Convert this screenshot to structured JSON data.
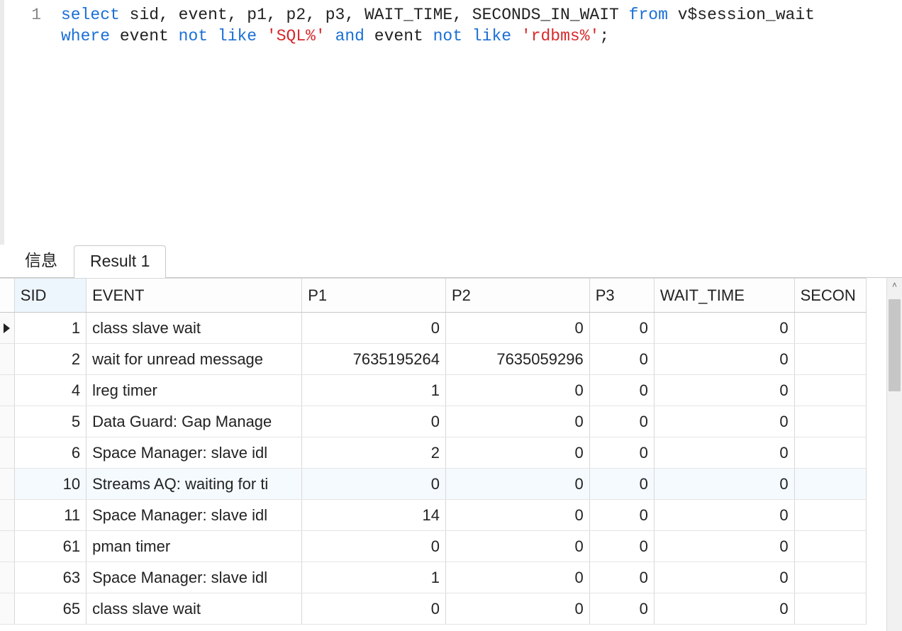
{
  "editor": {
    "line_number": "1",
    "tokens_line1": [
      {
        "t": "select",
        "c": "kw"
      },
      {
        "t": " ",
        "c": "id"
      },
      {
        "t": "sid",
        "c": "id"
      },
      {
        "t": ", ",
        "c": "punc"
      },
      {
        "t": "event",
        "c": "id"
      },
      {
        "t": ", ",
        "c": "punc"
      },
      {
        "t": "p1",
        "c": "id"
      },
      {
        "t": ", ",
        "c": "punc"
      },
      {
        "t": "p2",
        "c": "id"
      },
      {
        "t": ", ",
        "c": "punc"
      },
      {
        "t": "p3",
        "c": "id"
      },
      {
        "t": ", ",
        "c": "punc"
      },
      {
        "t": "WAIT_TIME",
        "c": "id"
      },
      {
        "t": ", ",
        "c": "punc"
      },
      {
        "t": "SECONDS_IN_WAIT",
        "c": "id"
      },
      {
        "t": " ",
        "c": "id"
      },
      {
        "t": "from",
        "c": "kw"
      },
      {
        "t": " ",
        "c": "id"
      },
      {
        "t": "v$session_wait",
        "c": "id"
      }
    ],
    "tokens_line2": [
      {
        "t": "where",
        "c": "kw"
      },
      {
        "t": " ",
        "c": "id"
      },
      {
        "t": "event",
        "c": "id"
      },
      {
        "t": " ",
        "c": "id"
      },
      {
        "t": "not",
        "c": "kw"
      },
      {
        "t": " ",
        "c": "id"
      },
      {
        "t": "like",
        "c": "kw"
      },
      {
        "t": " ",
        "c": "id"
      },
      {
        "t": "'SQL%'",
        "c": "str"
      },
      {
        "t": " ",
        "c": "id"
      },
      {
        "t": "and",
        "c": "kw"
      },
      {
        "t": " ",
        "c": "id"
      },
      {
        "t": "event",
        "c": "id"
      },
      {
        "t": " ",
        "c": "id"
      },
      {
        "t": "not",
        "c": "kw"
      },
      {
        "t": " ",
        "c": "id"
      },
      {
        "t": "like",
        "c": "kw"
      },
      {
        "t": " ",
        "c": "id"
      },
      {
        "t": "'rdbms%'",
        "c": "str"
      },
      {
        "t": ";",
        "c": "punc"
      }
    ]
  },
  "tabs": {
    "info_label": "信息",
    "result1_label": "Result 1"
  },
  "grid": {
    "columns": [
      "SID",
      "EVENT",
      "P1",
      "P2",
      "P3",
      "WAIT_TIME",
      "SECON"
    ],
    "full_last_column": "SECONDS_IN_WAIT",
    "rows": [
      {
        "sid": "1",
        "event": "class slave wait",
        "p1": "0",
        "p2": "0",
        "p3": "0",
        "wt": "0",
        "sec": "",
        "current": true
      },
      {
        "sid": "2",
        "event": "wait for unread message",
        "p1": "7635195264",
        "p2": "7635059296",
        "p3": "0",
        "wt": "0",
        "sec": ""
      },
      {
        "sid": "4",
        "event": "lreg timer",
        "p1": "1",
        "p2": "0",
        "p3": "0",
        "wt": "0",
        "sec": ""
      },
      {
        "sid": "5",
        "event": "Data Guard: Gap Manage",
        "p1": "0",
        "p2": "0",
        "p3": "0",
        "wt": "0",
        "sec": ""
      },
      {
        "sid": "6",
        "event": "Space Manager: slave idl",
        "p1": "2",
        "p2": "0",
        "p3": "0",
        "wt": "0",
        "sec": ""
      },
      {
        "sid": "10",
        "event": "Streams AQ: waiting for ti",
        "p1": "0",
        "p2": "0",
        "p3": "0",
        "wt": "0",
        "sec": "",
        "alt": true
      },
      {
        "sid": "11",
        "event": "Space Manager: slave idl",
        "p1": "14",
        "p2": "0",
        "p3": "0",
        "wt": "0",
        "sec": ""
      },
      {
        "sid": "61",
        "event": "pman timer",
        "p1": "0",
        "p2": "0",
        "p3": "0",
        "wt": "0",
        "sec": ""
      },
      {
        "sid": "63",
        "event": "Space Manager: slave idl",
        "p1": "1",
        "p2": "0",
        "p3": "0",
        "wt": "0",
        "sec": ""
      },
      {
        "sid": "65",
        "event": "class slave wait",
        "p1": "0",
        "p2": "0",
        "p3": "0",
        "wt": "0",
        "sec": ""
      }
    ]
  },
  "scroll": {
    "up_glyph": "˄",
    "down_glyph": "˅"
  }
}
